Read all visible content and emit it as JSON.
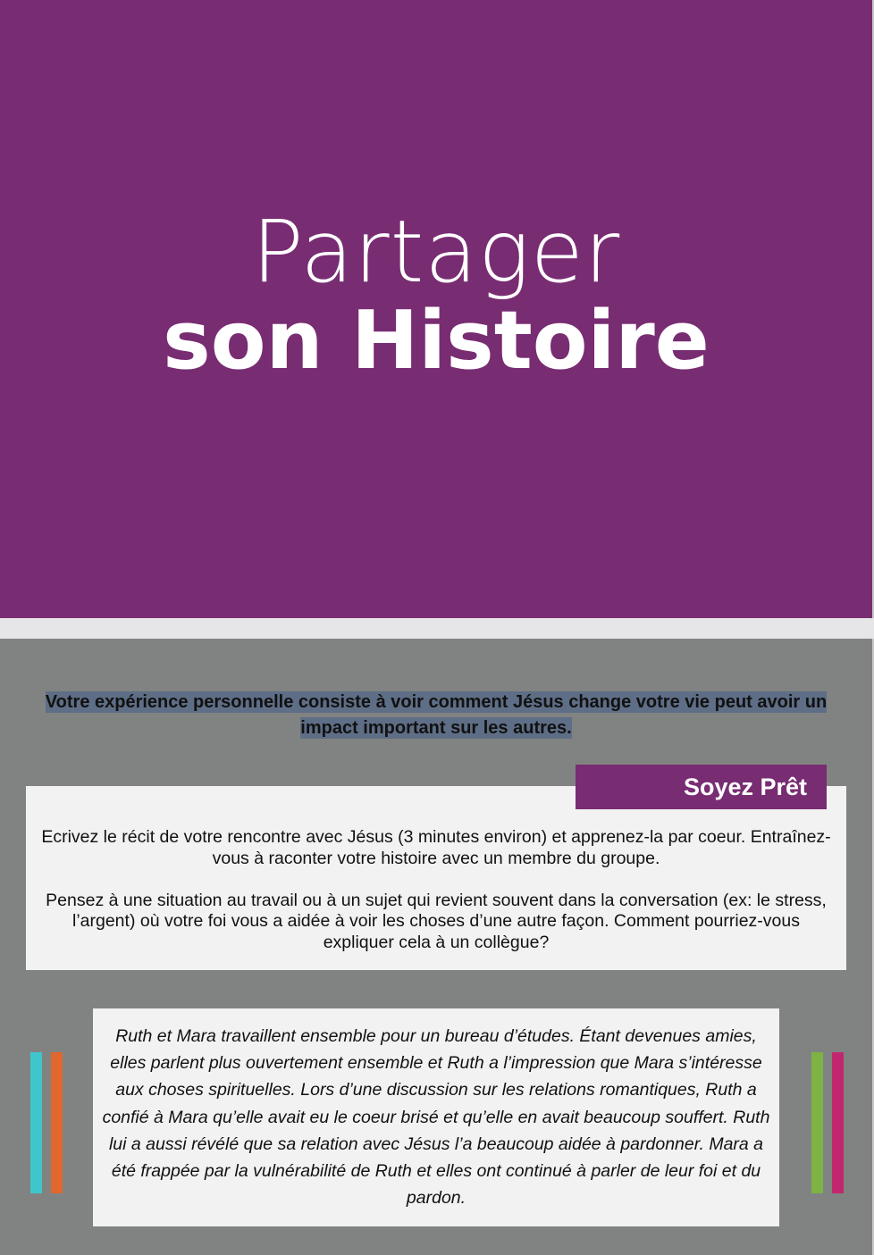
{
  "hero": {
    "title_line1": "Partager",
    "title_line2": "son Histoire",
    "background": "#782c72"
  },
  "intro": {
    "text": "Votre expérience personnelle consiste à voir comment Jésus change votre vie peut avoir un impact important sur les autres.",
    "highlight_color": "#5e6e86"
  },
  "ready_box": {
    "tag_label": "Soyez Prêt",
    "paragraph1": "Ecrivez le récit de votre rencontre avec Jésus (3 minutes environ) et apprenez-la par coeur. Entraînez-vous à raconter votre histoire avec un membre du groupe.",
    "paragraph2": "Pensez à une situation au travail ou à un sujet qui revient souvent dans la conversation (ex: le stress, l’argent) où votre foi vous a aidée à voir les choses d’une autre façon. Comment pourriez-vous expliquer cela à un collègue?"
  },
  "story": {
    "text": "Ruth et Mara travaillent ensemble pour un bureau d’études. Étant devenues amies, elles parlent plus ouvertement ensemble et Ruth a l’impression que Mara s’intéresse aux choses spirituelles. Lors d’une discussion sur les relations romantiques, Ruth a confié à Mara qu’elle avait eu le coeur brisé et qu’elle en avait beaucoup souffert. Ruth lui a aussi révélé que sa relation avec Jésus l’a beaucoup aidée à pardonner. Mara a été frappée par la vulnérabilité de Ruth et elles ont continué à parler de leur foi et du pardon."
  },
  "decor_bars": {
    "left": [
      "#3fc6cc",
      "#e0672d"
    ],
    "right": [
      "#7cb342",
      "#c2266f"
    ]
  }
}
